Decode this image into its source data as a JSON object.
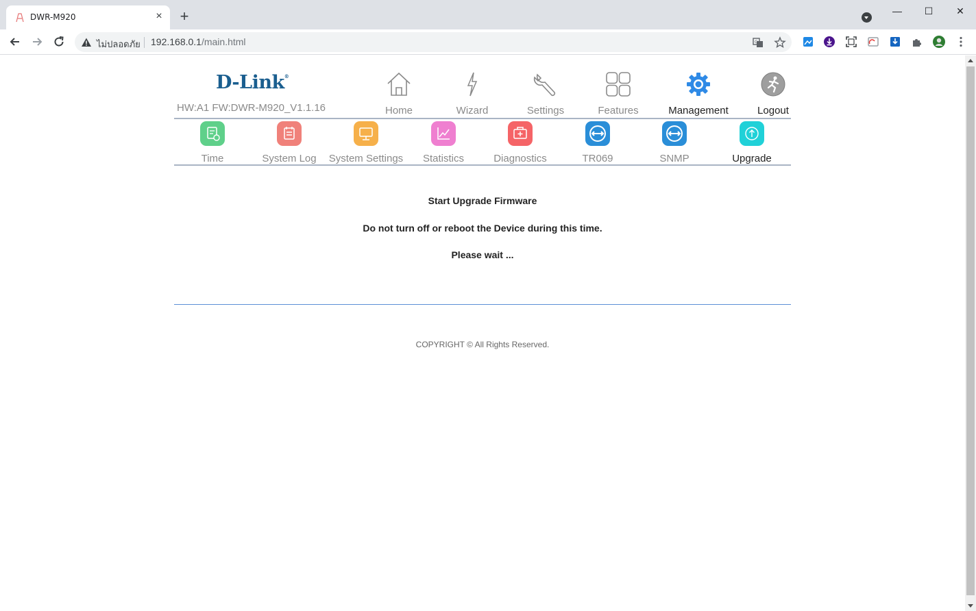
{
  "browser": {
    "tab_title": "DWR-M920",
    "tab_close": "×",
    "new_tab": "+",
    "security_label": "ไม่ปลอดภัย",
    "url_host": "192.168.0.1",
    "url_path": "/main.html",
    "window_controls": {
      "minimize": "—",
      "maximize": "☐",
      "close": "✕"
    }
  },
  "header": {
    "brand": "D-Link",
    "brand_mark": "®",
    "hw_fw": "HW:A1 FW:DWR-M920_V1.1.16"
  },
  "top_nav": [
    {
      "label": "Home",
      "icon": "home-icon",
      "active": false
    },
    {
      "label": "Wizard",
      "icon": "wizard-icon",
      "active": false
    },
    {
      "label": "Settings",
      "icon": "wrench-icon",
      "active": false
    },
    {
      "label": "Features",
      "icon": "grid-icon",
      "active": false
    },
    {
      "label": "Management",
      "icon": "gear-icon",
      "active": true
    },
    {
      "label": "Logout",
      "icon": "logout-icon",
      "active": false
    }
  ],
  "sub_nav": [
    {
      "label": "Time",
      "icon": "time-icon",
      "color": "#5fd08a"
    },
    {
      "label": "System Log",
      "icon": "system-log-icon",
      "color": "#f0817a"
    },
    {
      "label": "System Settings",
      "icon": "monitor-icon",
      "color": "#f6b04a"
    },
    {
      "label": "Statistics",
      "icon": "chart-icon",
      "color": "#ef7fd0"
    },
    {
      "label": "Diagnostics",
      "icon": "medkit-icon",
      "color": "#f56467"
    },
    {
      "label": "TR069",
      "icon": "tr069-icon",
      "color": "#2a8ed8"
    },
    {
      "label": "SNMP",
      "icon": "snmp-icon",
      "color": "#2a8ed8"
    },
    {
      "label": "Upgrade",
      "icon": "upload-icon",
      "color": "#20d1d8",
      "active": true
    }
  ],
  "content": {
    "line1": "Start Upgrade Firmware",
    "line2": "Do not turn off or reboot the Device during this time.",
    "line3": "Please wait ..."
  },
  "footer": {
    "copyright": "COPYRIGHT © All Rights Reserved."
  }
}
